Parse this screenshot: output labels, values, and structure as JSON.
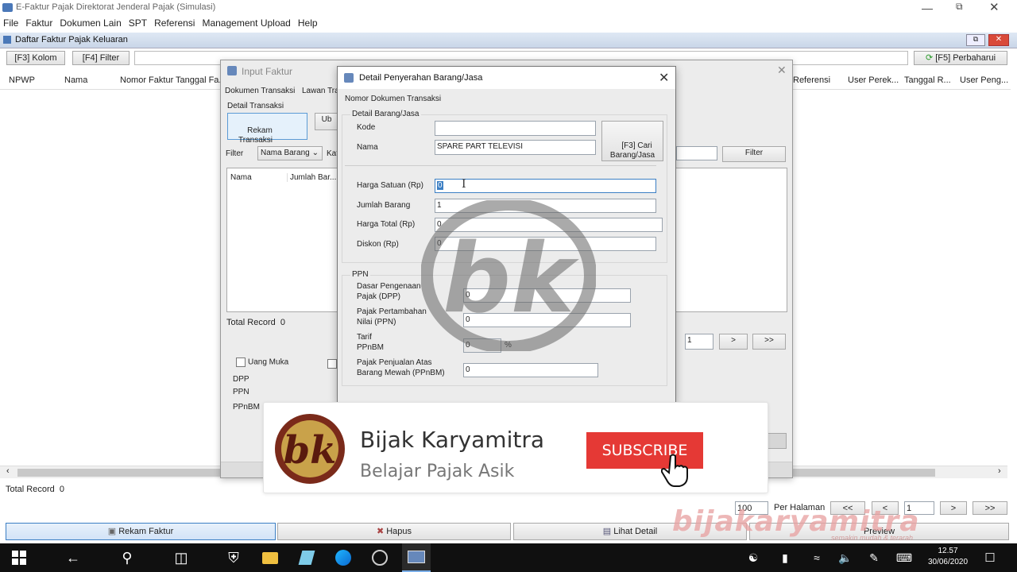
{
  "app": {
    "title": "E-Faktur Pajak Direktorat Jenderal Pajak (Simulasi)",
    "menu": [
      "File",
      "Faktur",
      "Dokumen Lain",
      "SPT",
      "Referensi",
      "Management Upload",
      "Help"
    ]
  },
  "main": {
    "title": "Daftar Faktur Pajak Keluaran",
    "btn_kolom": "[F3] Kolom",
    "btn_filter": "[F4] Filter",
    "btn_refresh": "[F5] Perbaharui",
    "columns_left": [
      "NPWP",
      "Nama",
      "Nomor Faktur",
      "Tanggal Fa..."
    ],
    "columns_right": [
      "Referensi",
      "User Perek...",
      "Tanggal R...",
      "User Peng..."
    ],
    "total_record": "Total Record  0",
    "per_page_value": "100",
    "per_page_label": "Per Halaman",
    "page_value": "1",
    "nav_first": "<<",
    "nav_prev": "<",
    "nav_next": ">",
    "nav_last": ">>",
    "btn_rekam": "Rekam Faktur",
    "btn_hapus": "Hapus",
    "btn_lihat": "Lihat Detail",
    "btn_preview": "Preview"
  },
  "input_faktur": {
    "title": "Input Faktur",
    "tab_dokumen": "Dokumen Transaksi",
    "tab_lawan": "Lawan Tra",
    "section": "Detail Transaksi",
    "btn_rekam_transaksi": "Rekam\nTransaksi",
    "btn_ubah": "Ub",
    "filter_label": "Filter",
    "filter_select": "Nama Barang",
    "kat_label": "Kat",
    "btn_filter": "Filter",
    "col_nama": "Nama",
    "col_jumlah": "Jumlah Bar...",
    "total_record": "Total Record  0",
    "page_value": "1",
    "nav_next": ">",
    "nav_last": ">>",
    "chk_uang_muka": "Uang Muka",
    "dpp": "DPP",
    "ppn": "PPN",
    "ppnbm": "PPnBM"
  },
  "detail": {
    "title": "Detail Penyerahan Barang/Jasa",
    "nomor_label": "Nomor Dokumen Transaksi",
    "group_barang": "Detail Barang/Jasa",
    "kode_label": "Kode",
    "kode_value": "",
    "nama_label": "Nama",
    "nama_value": "SPARE PART TELEVISI",
    "btn_cari": "[F3] Cari\nBarang/Jasa",
    "harga_satuan_label": "Harga Satuan (Rp)",
    "harga_satuan_value": "0",
    "jumlah_label": "Jumlah Barang",
    "jumlah_value": "1",
    "harga_total_label": "Harga Total (Rp)",
    "harga_total_value": "0",
    "diskon_label": "Diskon (Rp)",
    "diskon_value": "0",
    "group_ppn": "PPN",
    "dpp_label": "Dasar Pengenaan\nPajak (DPP)",
    "dpp_value": "0",
    "ppn_label": "Pajak Pertambahan\nNilai (PPN)",
    "ppn_value": "0",
    "tarif_label": "Tarif\nPPnBM",
    "tarif_value": "0",
    "tarif_unit": "%",
    "ppnbm_label": "Pajak Penjualan Atas\nBarang Mewah (PPnBM)",
    "ppnbm_value": "0"
  },
  "banner": {
    "name": "Bijak Karyamitra",
    "tagline": "Belajar Pajak Asik",
    "subscribe": "SUBSCRIBE",
    "logo_text": "bk",
    "watermark": "bijakaryamitra",
    "watermark_sub": "semakin mudah & terarah"
  },
  "taskbar": {
    "time": "12.57",
    "date": "30/06/2020",
    "icons": [
      "windows-start-icon",
      "back-arrow-icon",
      "search-icon",
      "task-view-icon",
      "security-shield-icon",
      "file-explorer-icon",
      "notepad-icon",
      "edge-browser-icon",
      "media-player-icon",
      "efaktur-app-icon"
    ]
  },
  "colors": {
    "accent": "#0078d7",
    "subscribe": "#e53935",
    "logo_brown": "#7a2a1a",
    "logo_gold": "#c9a24a",
    "watermark": "#e8a0a0"
  }
}
